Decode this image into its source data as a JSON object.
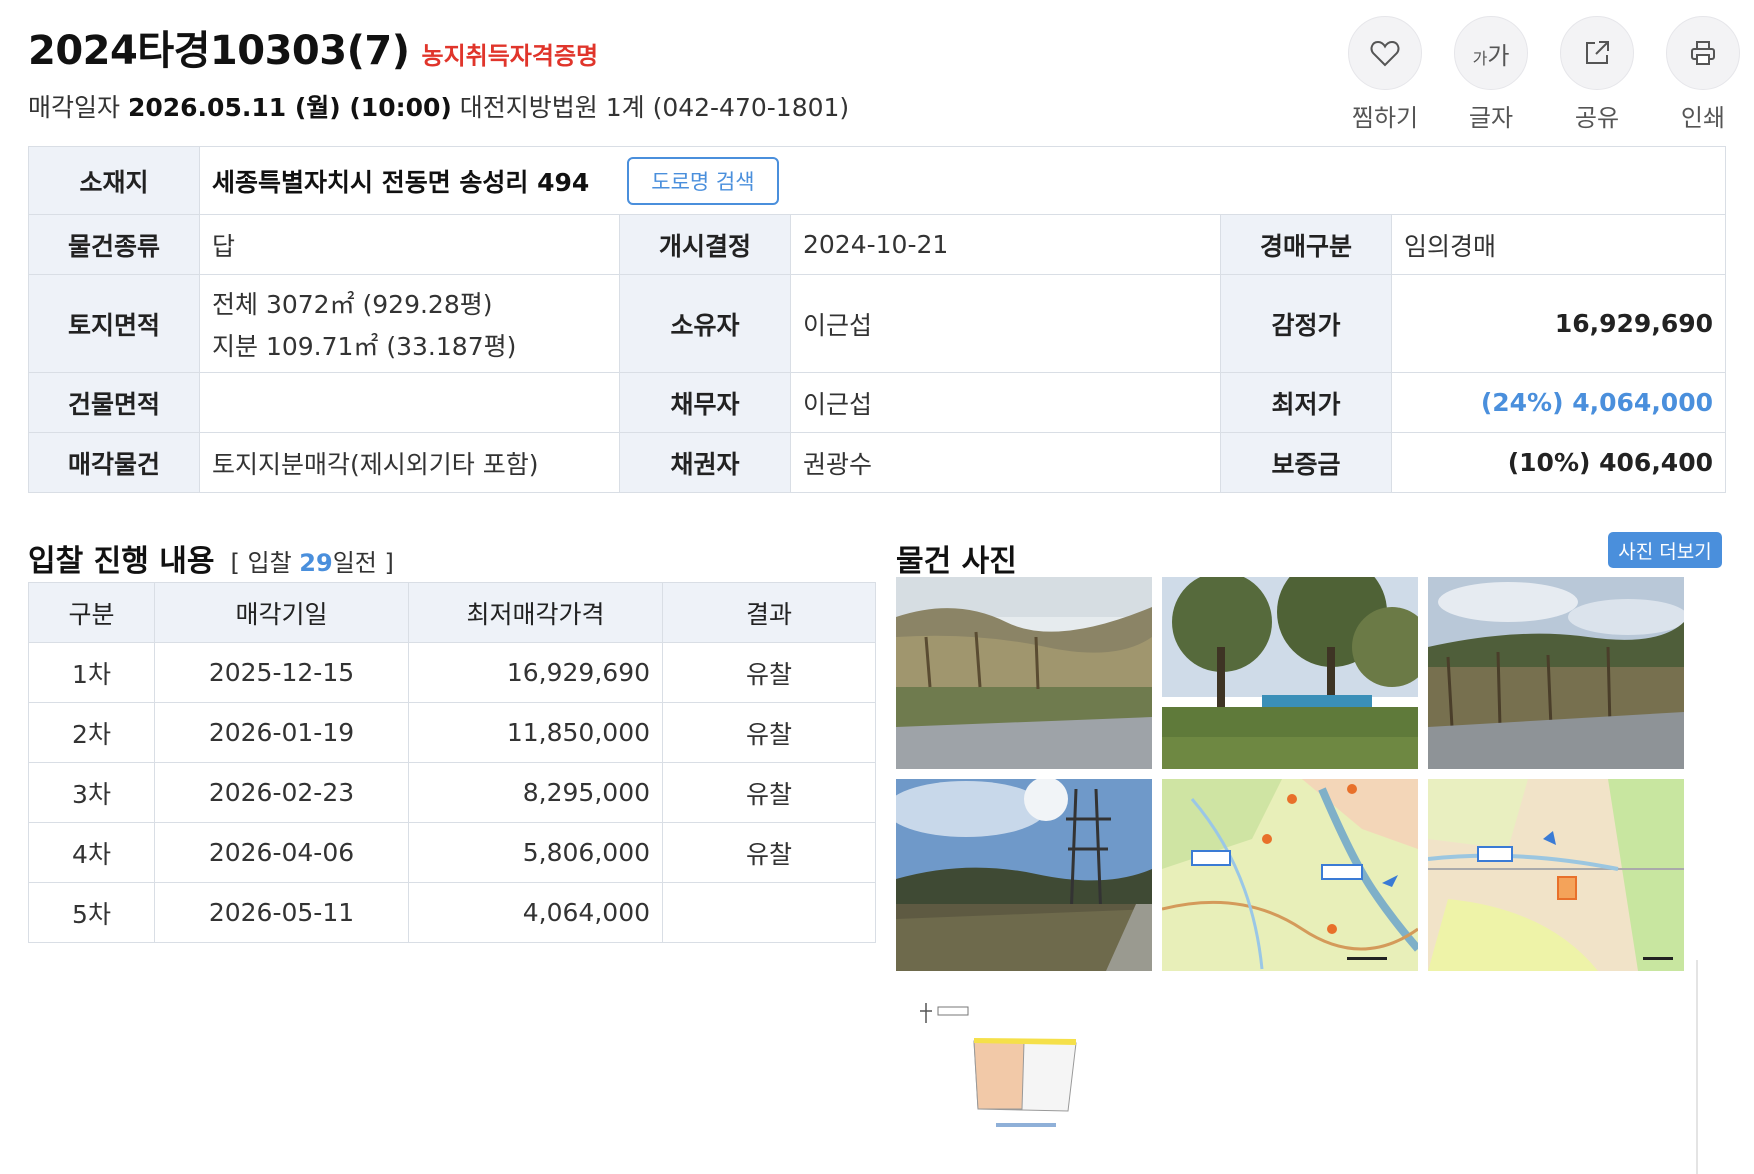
{
  "header": {
    "case_number": "2024타경10303(7)",
    "farm_cert": "농지취득자격증명",
    "sale_date_label": "매각일자",
    "sale_date": "2026.05.11 (월) (10:00)",
    "court": "대전지방법원 1계 (042-470-1801)"
  },
  "actions": {
    "favorite": "찜하기",
    "font_size": "글자",
    "font_icon_small": "가",
    "font_icon_large": "가",
    "share": "공유",
    "print": "인쇄"
  },
  "info": {
    "location_label": "소재지",
    "location": "세종특별자치시 전동면 송성리 494",
    "road_search_button": "도로명 검색",
    "type_label": "물건종류",
    "type": "답",
    "commence_label": "개시결정",
    "commence": "2024-10-21",
    "auction_kind_label": "경매구분",
    "auction_kind": "임의경매",
    "land_area_label": "토지면적",
    "land_area_total": "전체 3072㎡ (929.28평)",
    "land_area_share": "지분 109.71㎡ (33.187평)",
    "owner_label": "소유자",
    "owner": "이근섭",
    "appraisal_label": "감정가",
    "appraisal": "16,929,690",
    "building_area_label": "건물면적",
    "building_area": "",
    "debtor_label": "채무자",
    "debtor": "이근섭",
    "min_price_label": "최저가",
    "min_price": "(24%) 4,064,000",
    "sale_item_label": "매각물건",
    "sale_item": "토지지분매각(제시외기타 포함)",
    "creditor_label": "채권자",
    "creditor": "권광수",
    "deposit_label": "보증금",
    "deposit": "(10%) 406,400"
  },
  "bidding": {
    "title": "입찰 진행 내용",
    "dday_prefix": "[ 입찰 ",
    "dday_number": "29",
    "dday_suffix": "일전 ]",
    "columns": [
      "구분",
      "매각기일",
      "최저매각가격",
      "결과"
    ],
    "rows": [
      {
        "round": "1차",
        "date": "2025-12-15",
        "price": "16,929,690",
        "result": "유찰"
      },
      {
        "round": "2차",
        "date": "2026-01-19",
        "price": "11,850,000",
        "result": "유찰"
      },
      {
        "round": "3차",
        "date": "2026-02-23",
        "price": "8,295,000",
        "result": "유찰"
      },
      {
        "round": "4차",
        "date": "2026-04-06",
        "price": "5,806,000",
        "result": "유찰"
      },
      {
        "round": "5차",
        "date": "2026-05-11",
        "price": "4,064,000",
        "result": ""
      }
    ]
  },
  "photos": {
    "title": "물건 사진",
    "more_button": "사진 더보기"
  },
  "colors": {
    "accent_blue": "#4a8fdc",
    "red": "#e0352b",
    "header_bg": "#eef2f8",
    "border": "#d9dee5"
  },
  "icons": [
    "heart-icon",
    "font-size-icon",
    "share-icon",
    "print-icon"
  ]
}
